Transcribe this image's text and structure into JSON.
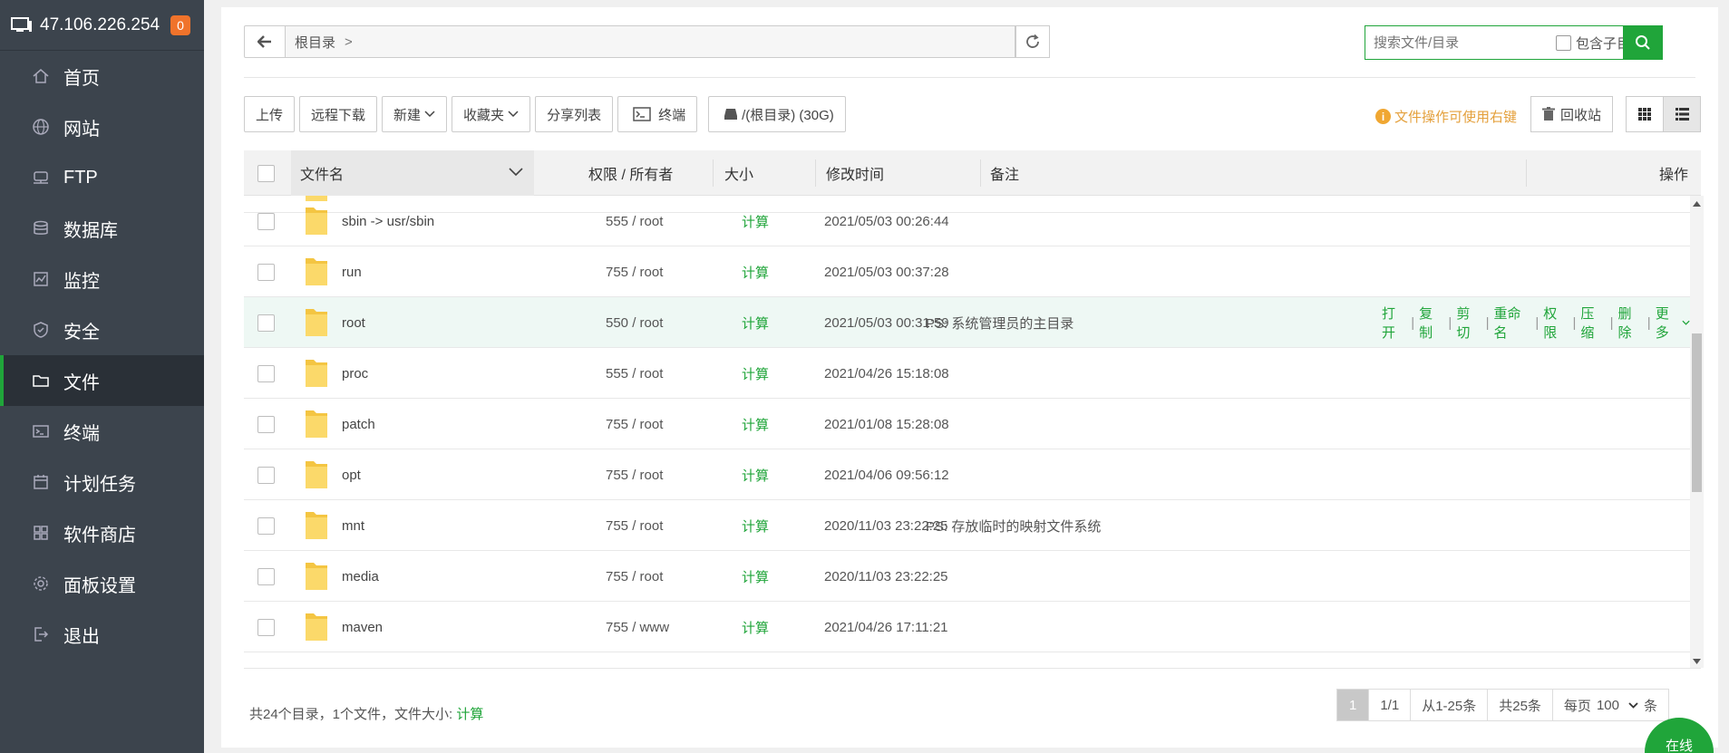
{
  "sidebar": {
    "host": "47.106.226.254",
    "badge": "0",
    "items": [
      {
        "label": "首页",
        "icon": "home-icon"
      },
      {
        "label": "网站",
        "icon": "globe-icon"
      },
      {
        "label": "FTP",
        "icon": "ftp-icon"
      },
      {
        "label": "数据库",
        "icon": "database-icon"
      },
      {
        "label": "监控",
        "icon": "monitor-chart-icon"
      },
      {
        "label": "安全",
        "icon": "shield-icon"
      },
      {
        "label": "文件",
        "icon": "folder-icon"
      },
      {
        "label": "终端",
        "icon": "terminal-icon"
      },
      {
        "label": "计划任务",
        "icon": "calendar-icon"
      },
      {
        "label": "软件商店",
        "icon": "apps-icon"
      },
      {
        "label": "面板设置",
        "icon": "gear-icon"
      },
      {
        "label": "退出",
        "icon": "logout-icon"
      }
    ],
    "active_index": 6
  },
  "path": {
    "crumb": "根目录",
    "crumb_sep": ">"
  },
  "search": {
    "placeholder": "搜索文件/目录",
    "include_sub": "包含子目录"
  },
  "toolbar": {
    "upload": "上传",
    "remote_download": "远程下载",
    "new": "新建",
    "favorites": "收藏夹",
    "share_list": "分享列表",
    "terminal": "终端",
    "disk": "/(根目录) (30G)",
    "tip": "文件操作可使用右键",
    "recycle": "回收站"
  },
  "table": {
    "headers": {
      "name": "文件名",
      "perm": "权限 / 所有者",
      "size": "大小",
      "mtime": "修改时间",
      "note": "备注",
      "ops": "操作"
    },
    "rows": [
      {
        "name": "sbin -> usr/sbin",
        "perm": "555 / root",
        "size": "计算",
        "mtime": "2021/05/03 00:26:44",
        "note": ""
      },
      {
        "name": "run",
        "perm": "755 / root",
        "size": "计算",
        "mtime": "2021/05/03 00:37:28",
        "note": ""
      },
      {
        "name": "root",
        "perm": "550 / root",
        "size": "计算",
        "mtime": "2021/05/03 00:31:59",
        "note": "PS: 系统管理员的主目录"
      },
      {
        "name": "proc",
        "perm": "555 / root",
        "size": "计算",
        "mtime": "2021/04/26 15:18:08",
        "note": ""
      },
      {
        "name": "patch",
        "perm": "755 / root",
        "size": "计算",
        "mtime": "2021/01/08 15:28:08",
        "note": ""
      },
      {
        "name": "opt",
        "perm": "755 / root",
        "size": "计算",
        "mtime": "2021/04/06 09:56:12",
        "note": ""
      },
      {
        "name": "mnt",
        "perm": "755 / root",
        "size": "计算",
        "mtime": "2020/11/03 23:22:25",
        "note": "PS: 存放临时的映射文件系统"
      },
      {
        "name": "media",
        "perm": "755 / root",
        "size": "计算",
        "mtime": "2020/11/03 23:22:25",
        "note": ""
      },
      {
        "name": "maven",
        "perm": "755 / www",
        "size": "计算",
        "mtime": "2021/04/26 17:11:21",
        "note": ""
      }
    ],
    "row_ops": [
      "打开",
      "复制",
      "剪切",
      "重命名",
      "权限",
      "压缩",
      "删除",
      "更多"
    ]
  },
  "footer": {
    "summary": "共24个目录，1个文件，文件大小: ",
    "summary_calc": "计算",
    "page_current": "1",
    "page_total": "1/1",
    "range": "从1-25条",
    "total": "共25条",
    "per_page_label": "每页",
    "per_page_value": "100",
    "per_page_unit": "条"
  },
  "online": "在线",
  "colors": {
    "accent": "#20a53a",
    "sidebar_bg": "#3c444d",
    "tip": "#e4a03c",
    "badge": "#f0732b"
  }
}
